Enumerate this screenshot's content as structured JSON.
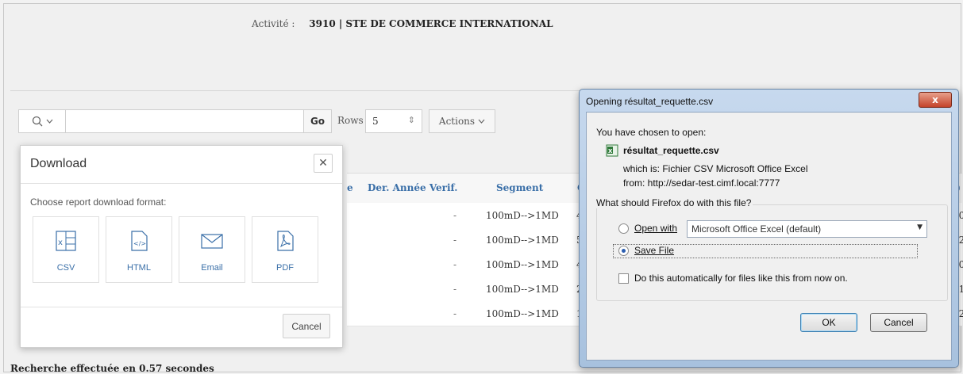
{
  "activity": {
    "label": "Activité :",
    "value": "3910 | STE DE COMMERCE INTERNATIONAL"
  },
  "toolbar": {
    "go_label": "Go",
    "rows_label": "Rows",
    "rows_value": "5",
    "actions_label": "Actions"
  },
  "table": {
    "columns": [
      "e",
      "Der. Année Verif.",
      "Segment",
      "C",
      "A)"
    ],
    "rows": [
      {
        "c1": "-",
        "c2": "100mD-->1MD",
        "c3": "4",
        "c4": "00"
      },
      {
        "c1": "-",
        "c2": "100mD-->1MD",
        "c3": "5",
        "c4": "92"
      },
      {
        "c1": "-",
        "c2": "100mD-->1MD",
        "c3": "4",
        "c4": "00"
      },
      {
        "c1": "-",
        "c2": "100mD-->1MD",
        "c3": "2",
        "c4": "81"
      },
      {
        "c1": "-",
        "c2": "100mD-->1MD",
        "c3": "1",
        "c4": "62"
      }
    ]
  },
  "status": "Recherche effectuée en 0.57 secondes",
  "download": {
    "title": "Download",
    "prompt": "Choose report download format:",
    "formats": [
      {
        "label": "CSV",
        "icon": "csv-file-icon"
      },
      {
        "label": "HTML",
        "icon": "html-file-icon"
      },
      {
        "label": "Email",
        "icon": "envelope-icon"
      },
      {
        "label": "PDF",
        "icon": "pdf-file-icon"
      }
    ],
    "cancel_label": "Cancel"
  },
  "firefox": {
    "title": "Opening résultat_requette.csv",
    "chosen": "You have chosen to open:",
    "filename": "résultat_requette.csv",
    "which_is": "which is:  Fichier CSV Microsoft Office Excel",
    "from": "from:  http://sedar-test.cimf.local:7777",
    "question": "What should Firefox do with this file?",
    "open_with_label": "Open with",
    "open_with_value": "Microsoft Office Excel (default)",
    "save_file_label": "Save File",
    "auto_label": "Do this automatically for files like this from now on.",
    "ok_label": "OK",
    "cancel_label": "Cancel",
    "close_glyph": "x"
  },
  "colors": {
    "accent": "#3a6fa8",
    "title_bar": "#b9cfe8",
    "close_red": "#c4432a"
  }
}
